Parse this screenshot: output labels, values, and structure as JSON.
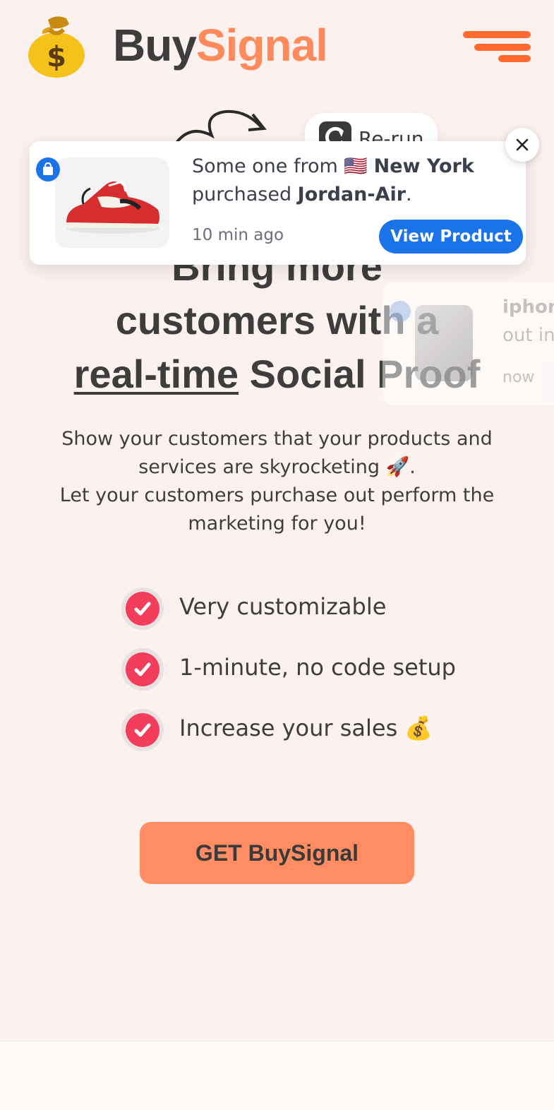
{
  "header": {
    "brand_part1": "Buy",
    "brand_part2": "Signal",
    "logo_icon": "money-bag-icon",
    "menu_icon": "hamburger-menu-icon"
  },
  "rerun": {
    "label": "Re-run",
    "icon": "refresh-icon"
  },
  "hero": {
    "line1": "Bring more",
    "line2": "customers with a",
    "line3_underlined": "real-time",
    "line3_rest": " Social Proof"
  },
  "toast": {
    "badge_icon": "shopping-bag-icon",
    "product_image": "sneaker-image",
    "msg_prefix": "Some one from ",
    "flag": "🇺🇸",
    "location": "New York",
    "msg_mid": "purchased ",
    "product": "Jordan-Air",
    "msg_end": ".",
    "time": "10 min ago",
    "view_button": "View Product"
  },
  "ghost_toast": {
    "line1": "iphon",
    "line2": "out in",
    "line3": "now"
  },
  "subtext": {
    "p1": "Show your customers that your products and services are skyrocketing 🚀.",
    "p2": "Let your customers purchase out perform the marketing for you!"
  },
  "features": [
    {
      "label": "Very customizable"
    },
    {
      "label": "1-minute, no code setup"
    },
    {
      "label": "Increase your sales 💰"
    }
  ],
  "cta": {
    "label": "GET BuySignal"
  },
  "colors": {
    "accent": "#ff8a5c",
    "blue": "#1a73e8",
    "check": "#f23d5c",
    "background": "#fbf2ef"
  }
}
